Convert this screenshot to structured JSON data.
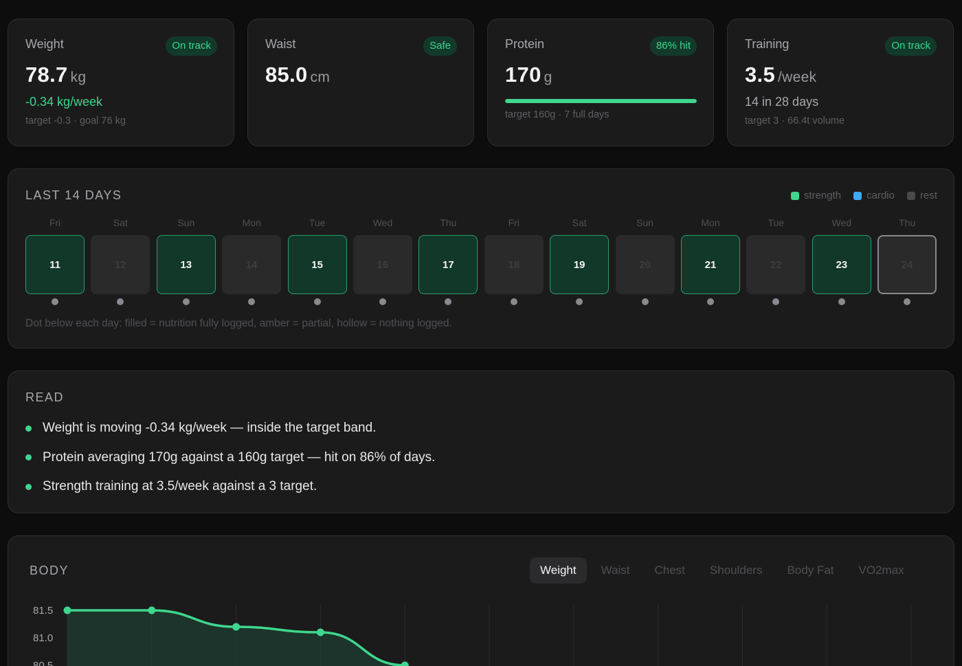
{
  "kpis": [
    {
      "label": "Weight",
      "badge": "On track",
      "value": "78.7",
      "unit": "kg",
      "sub": "-0.34 kg/week",
      "note": "target -0.3 · goal 76 kg"
    },
    {
      "label": "Waist",
      "badge": "Safe",
      "value": "85.0",
      "unit": "cm"
    },
    {
      "label": "Protein",
      "badge": "86% hit",
      "value": "170",
      "unit": "g",
      "progress": 1.0,
      "note": "target 160g · 7 full days"
    },
    {
      "label": "Training",
      "badge": "On track",
      "value": "3.5",
      "unit": "/week",
      "sub": "14 in 28 days",
      "note": "target 3 · 66.4t volume"
    }
  ],
  "last14": {
    "title": "LAST 14 DAYS",
    "legend": [
      {
        "label": "strength",
        "color": "#3fd68e"
      },
      {
        "label": "cardio",
        "color": "#3fa9f5"
      },
      {
        "label": "rest",
        "color": "#4a4a4d"
      }
    ],
    "days": [
      {
        "dow": "Fri",
        "num": "11",
        "type": "strength"
      },
      {
        "dow": "Sat",
        "num": "12",
        "type": "rest"
      },
      {
        "dow": "Sun",
        "num": "13",
        "type": "strength"
      },
      {
        "dow": "Mon",
        "num": "14",
        "type": "rest"
      },
      {
        "dow": "Tue",
        "num": "15",
        "type": "strength"
      },
      {
        "dow": "Wed",
        "num": "16",
        "type": "rest"
      },
      {
        "dow": "Thu",
        "num": "17",
        "type": "strength"
      },
      {
        "dow": "Fri",
        "num": "18",
        "type": "rest"
      },
      {
        "dow": "Sat",
        "num": "19",
        "type": "strength"
      },
      {
        "dow": "Sun",
        "num": "20",
        "type": "rest"
      },
      {
        "dow": "Mon",
        "num": "21",
        "type": "strength"
      },
      {
        "dow": "Tue",
        "num": "22",
        "type": "rest"
      },
      {
        "dow": "Wed",
        "num": "23",
        "type": "strength"
      },
      {
        "dow": "Thu",
        "num": "24",
        "type": "today"
      }
    ],
    "note": "Dot below each day: filled = nutrition fully logged, amber = partial, hollow = nothing logged."
  },
  "read": {
    "title": "READ",
    "items": [
      "Weight is moving -0.34 kg/week — inside the target band.",
      "Protein averaging 170g against a 160g target — hit on 86% of days.",
      "Strength training at 3.5/week against a 3 target."
    ]
  },
  "body": {
    "title": "BODY",
    "tabs": [
      "Weight",
      "Waist",
      "Chest",
      "Shoulders",
      "Body Fat",
      "VO2max"
    ],
    "active_tab": "Weight"
  },
  "chart_data": {
    "type": "area",
    "y_ticks": [
      "81.5",
      "81.0",
      "80.5"
    ],
    "ylim": [
      80.4,
      81.6
    ],
    "x_count": 11,
    "series": [
      {
        "values": [
          81.5,
          81.5,
          81.2,
          81.1,
          80.5
        ]
      }
    ],
    "color": "#3fd68e",
    "grid": true
  }
}
